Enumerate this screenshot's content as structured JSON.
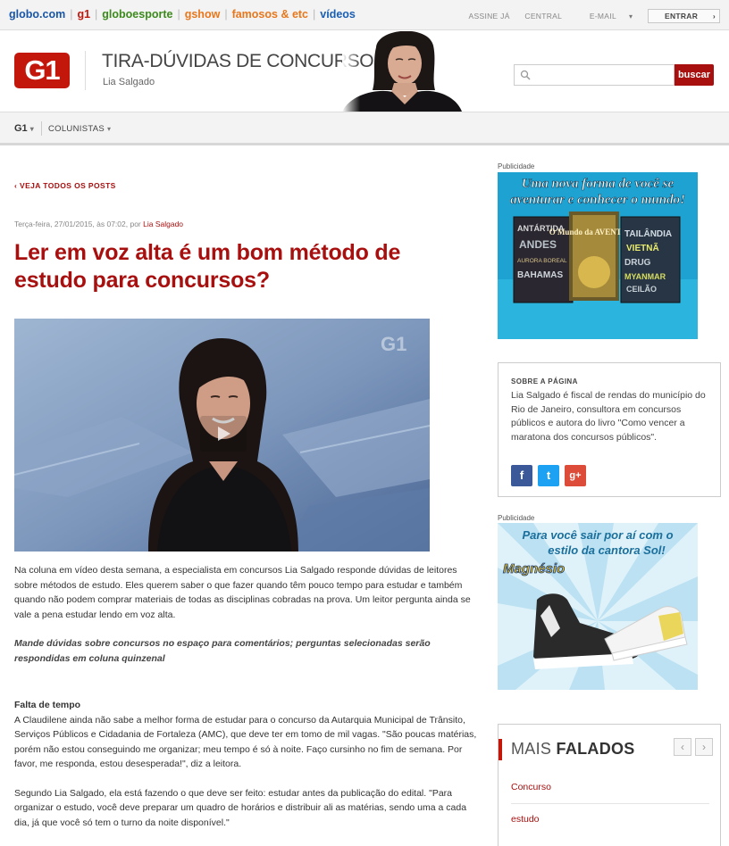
{
  "globo_bar": {
    "links": [
      "globo.com",
      "g1",
      "globoesporte",
      "gshow",
      "famosos & etc",
      "vídeos"
    ],
    "right": [
      "ASSINE JÁ",
      "CENTRAL",
      "E-MAIL",
      "ENTRAR"
    ]
  },
  "header": {
    "logo": "G1",
    "blog_title": "TIRA-DÚVIDAS DE CONCURSOS",
    "author": "Lia Salgado",
    "search_placeholder": "",
    "search_button": "buscar"
  },
  "nav": {
    "g1": "G1",
    "colunistas": "COLUNISTAS"
  },
  "post": {
    "back_link": "VEJA TODOS OS POSTS",
    "meta_date": "Terça-feira, 27/01/2015, às 07:02, por",
    "meta_author": "Lia Salgado",
    "title": "Ler em voz alta é um bom método de estudo para concursos?",
    "video_logo": "G1",
    "paragraphs": {
      "p1": "Na coluna em vídeo desta semana, a especialista em concursos Lia Salgado responde dúvidas de leitores sobre métodos de estudo. Eles querem saber o que fazer quando têm pouco tempo para estudar e também quando não podem comprar materiais de todas as disciplinas cobradas na prova. Um leitor pergunta ainda se vale a pena estudar lendo em voz alta.",
      "p2": "Mande dúvidas sobre concursos no espaço para comentários; perguntas selecionadas serão respondidas em coluna quinzenal",
      "subtitle": "Falta de tempo",
      "p3": "A Claudilene ainda não sabe a melhor forma de estudar para o concurso da Autarquia Municipal de Trânsito, Serviços Públicos e Cidadania de Fortaleza (AMC), que deve ter em tomo de mil vagas. \"São poucas matérias, porém não estou conseguindo me organizar; meu tempo é só à noite. Faço cursinho no fim de semana. Por favor, me responda, estou desesperada!\", diz a leitora.",
      "p4": "Segundo Lia Salgado, ela está fazendo o que deve ser feito: estudar antes da publicação do edital. \"Para organizar o estudo, você deve preparar um quadro de horários e distribuir ali as matérias, sendo uma a cada dia, já que você só tem o turno da noite disponível.\""
    }
  },
  "sidebar": {
    "pub_label": "Publicidade",
    "ad1": {
      "headline_1": "Uma nova forma de você se",
      "headline_2": "aventurar e conhecer o mundo!",
      "book_1": [
        "ANTÁRTIDA",
        "ANDES",
        "AURORA BOREAL",
        "BAHAMAS"
      ],
      "book_2": "O Mundo da AVENTURA",
      "book_3": [
        "TAILÂNDIA",
        "VIETNÃ",
        "DRUG",
        "MYANMAR",
        "CEILÃO"
      ]
    },
    "about": {
      "heading": "SOBRE A PÁGINA",
      "text": "Lia Salgado é fiscal de rendas do município do Rio de Janeiro, consultora em concursos públicos e autora do livro \"Como vencer a maratona dos concursos públicos\".",
      "social": [
        "f",
        "t",
        "g+"
      ]
    },
    "ad2": {
      "headline_1": "Para você sair por aí com o",
      "headline_2": "estilo da cantora Sol!",
      "brand": "Magnésio"
    },
    "mais_falados": {
      "title_light": "MAIS ",
      "title_bold": "FALADOS",
      "prev": "‹",
      "next": "›",
      "items": [
        "Concurso",
        "estudo"
      ]
    }
  }
}
